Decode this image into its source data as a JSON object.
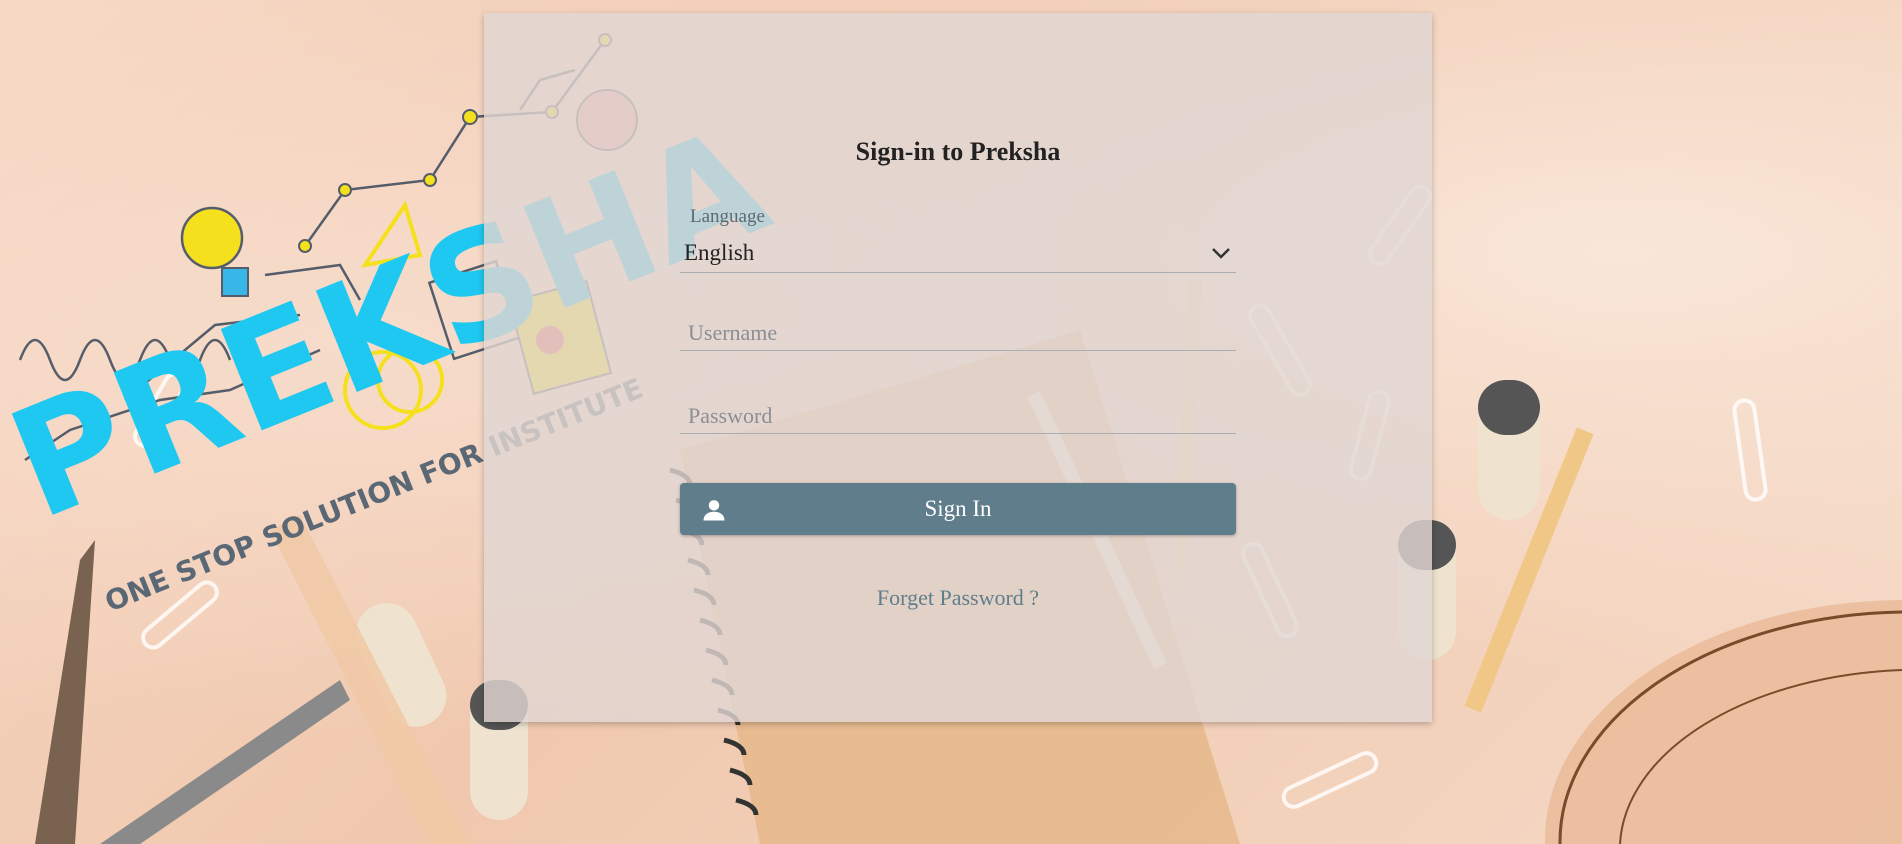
{
  "login": {
    "title": "Sign-in to Preksha",
    "language_label": "Language",
    "language_value": "English",
    "username_placeholder": "Username",
    "password_placeholder": "Password",
    "sign_in_label": "Sign In",
    "forgot_label": "Forget Password ?"
  },
  "logo": {
    "brand": "PREKSHA",
    "tagline": "ONE STOP SOLUTION FOR INSTITUTE"
  },
  "colors": {
    "button": "#607d8b",
    "brand_blue": "#1ec8f0",
    "accent_yellow": "#f5e01e"
  },
  "icons": [
    "person-icon",
    "chevron-down-icon",
    "lightbulb-icon"
  ]
}
